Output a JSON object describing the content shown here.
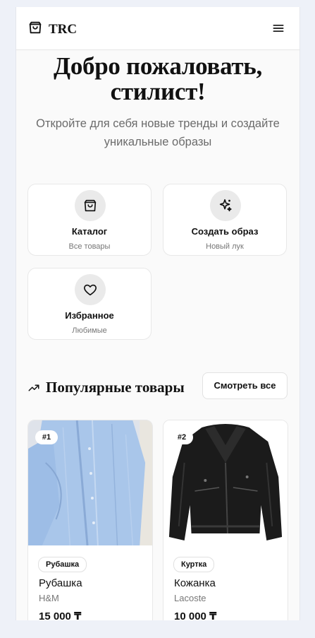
{
  "header": {
    "logo_text": "TRC",
    "logo_icon": "shopping-bag-icon",
    "menu_icon": "menu-icon"
  },
  "hero": {
    "title_line1": "Добро пожаловать,",
    "title_line2": "стилист!",
    "subtitle_line1": "Откройте для себя новые тренды и создайте",
    "subtitle_line2": "уникальные образы"
  },
  "quick_links": [
    {
      "icon": "shopping-bag-icon",
      "title": "Каталог",
      "subtitle": "Все товары"
    },
    {
      "icon": "sparkles-icon",
      "title": "Создать образ",
      "subtitle": "Новый лук"
    },
    {
      "icon": "heart-icon",
      "title": "Избранное",
      "subtitle": "Любимые"
    }
  ],
  "popular": {
    "icon": "trending-up-icon",
    "title": "Популярные товары",
    "see_all_label": "Смотреть все",
    "products": [
      {
        "rank": "#1",
        "tag": "Рубашка",
        "name": "Рубашка",
        "brand": "H&M",
        "price": "15 000 ₸",
        "image": "light-blue-shirt"
      },
      {
        "rank": "#2",
        "tag": "Куртка",
        "name": "Кожанка",
        "brand": "Lacoste",
        "price": "10 000 ₸",
        "image": "black-leather-jacket"
      }
    ]
  }
}
